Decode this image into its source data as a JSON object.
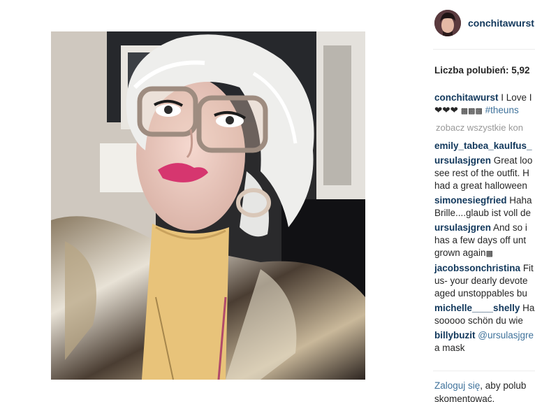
{
  "post": {
    "username": "conchitawurst",
    "likes_text": "Liczba polubień: 5,92",
    "caption_user": "conchitawurst",
    "caption_line1": "I Love I",
    "caption_line2_hearts": "❤❤❤",
    "caption_line2_tag": "#theuns",
    "see_all_text": "zobacz wszystkie kon"
  },
  "comments": [
    {
      "user": "emily_tabea_kaulfus_",
      "lines": [
        ""
      ]
    },
    {
      "user": "ursulasjgren",
      "lines": [
        "Great loo",
        "see rest of the outfit. H",
        "had a great halloween"
      ]
    },
    {
      "user": "simonesiegfried",
      "lines": [
        "Haha",
        "Brille....glaub ist voll de"
      ]
    },
    {
      "user": "ursulasjgren",
      "lines": [
        "And so i",
        "has a few days off unt",
        "grown again"
      ]
    },
    {
      "user": "jacobssonchristina",
      "lines": [
        "Fit",
        "us- your dearly devote",
        "aged unstoppables bu"
      ]
    },
    {
      "user": "michelle____shelly",
      "lines": [
        "Ha",
        "sooooo schön du wie"
      ]
    },
    {
      "user": "billybuzit",
      "lines": [
        "@ursulasjgre",
        "a mask"
      ]
    }
  ],
  "footer": {
    "login_link": "Zaloguj się",
    "rest1": ", aby polub",
    "line2": "skomentować."
  }
}
